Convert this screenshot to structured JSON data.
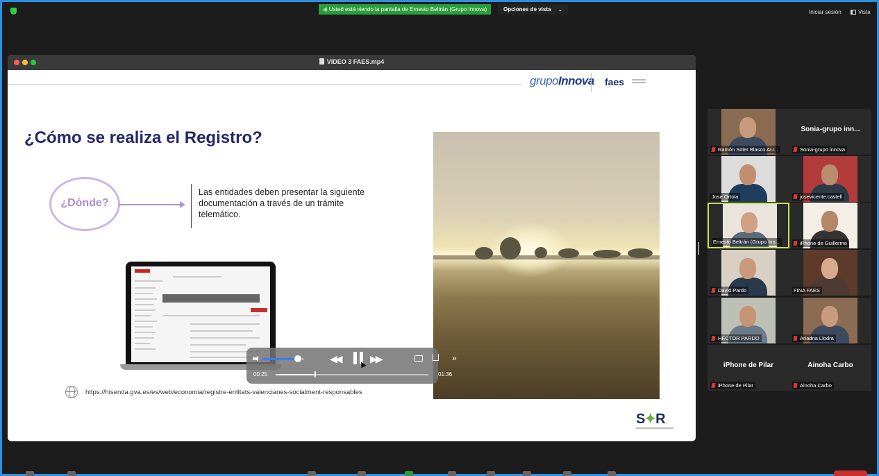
{
  "topbar": {
    "share_banner": "Usted está viendo la pantalla de Ernesto Beltrán (Grupo Innova)",
    "view_options": "Opciones de vista",
    "view_options_chevron": "⌄",
    "sign_in": "Iniciar sesión",
    "view": "Vista"
  },
  "video_window": {
    "title": "VIDEO 3 FAES.mp4"
  },
  "slide": {
    "logo_grupo": "grupo",
    "logo_innova": "Innova",
    "logo_faes": "faes",
    "title": "¿Cómo se realiza el Registro?",
    "donde": "¿Dónde?",
    "description": "Las entidades deben presentar la siguiente documentación a través de un trámite telemático.",
    "url": "https://hisenda.gva.es/es/web/economia/registre-entitats-valencianes-socialment-responsables",
    "sr_logo_s": "S",
    "sr_logo_r": "R"
  },
  "player": {
    "current_time": "00:25",
    "duration": "01:36",
    "progress_fraction": 0.26,
    "volume_fraction": 0.85,
    "rewind_glyph": "◀◀",
    "forward_glyph": "▶▶",
    "more_glyph": "»"
  },
  "participants": [
    {
      "name": "Ramón Soler Blasco AU...",
      "muted": true,
      "video": true
    },
    {
      "name": "Sonia-grupo innova",
      "label": "Sonia-grupo  inn...",
      "muted": true,
      "video": false
    },
    {
      "name": "Jose Ortola",
      "muted": false,
      "video": true
    },
    {
      "name": "josevicente.castell",
      "muted": true,
      "video": true
    },
    {
      "name": "Ernesto Beltrán (Grupo Inn...",
      "muted": false,
      "video": true,
      "active": true
    },
    {
      "name": "iPhone de Guillermo",
      "muted": true,
      "video": true
    },
    {
      "name": "David Pardo",
      "muted": true,
      "video": true
    },
    {
      "name": "FINA FAES",
      "muted": false,
      "video": true
    },
    {
      "name": "HECTOR PARDO",
      "muted": true,
      "video": true
    },
    {
      "name": "Ariadna Llodra",
      "muted": true,
      "video": true
    },
    {
      "name": "iPhone de Pilar",
      "label": "iPhone de Pilar",
      "muted": true,
      "video": false
    },
    {
      "name": "Ainoha Carbo",
      "label": "Ainoha Carbo",
      "muted": true,
      "video": false
    }
  ],
  "colors": {
    "accent_border": "#2f8fe0",
    "share_banner": "#2a9d3a",
    "active_speaker": "#c6e35a",
    "title_navy": "#24286d"
  }
}
